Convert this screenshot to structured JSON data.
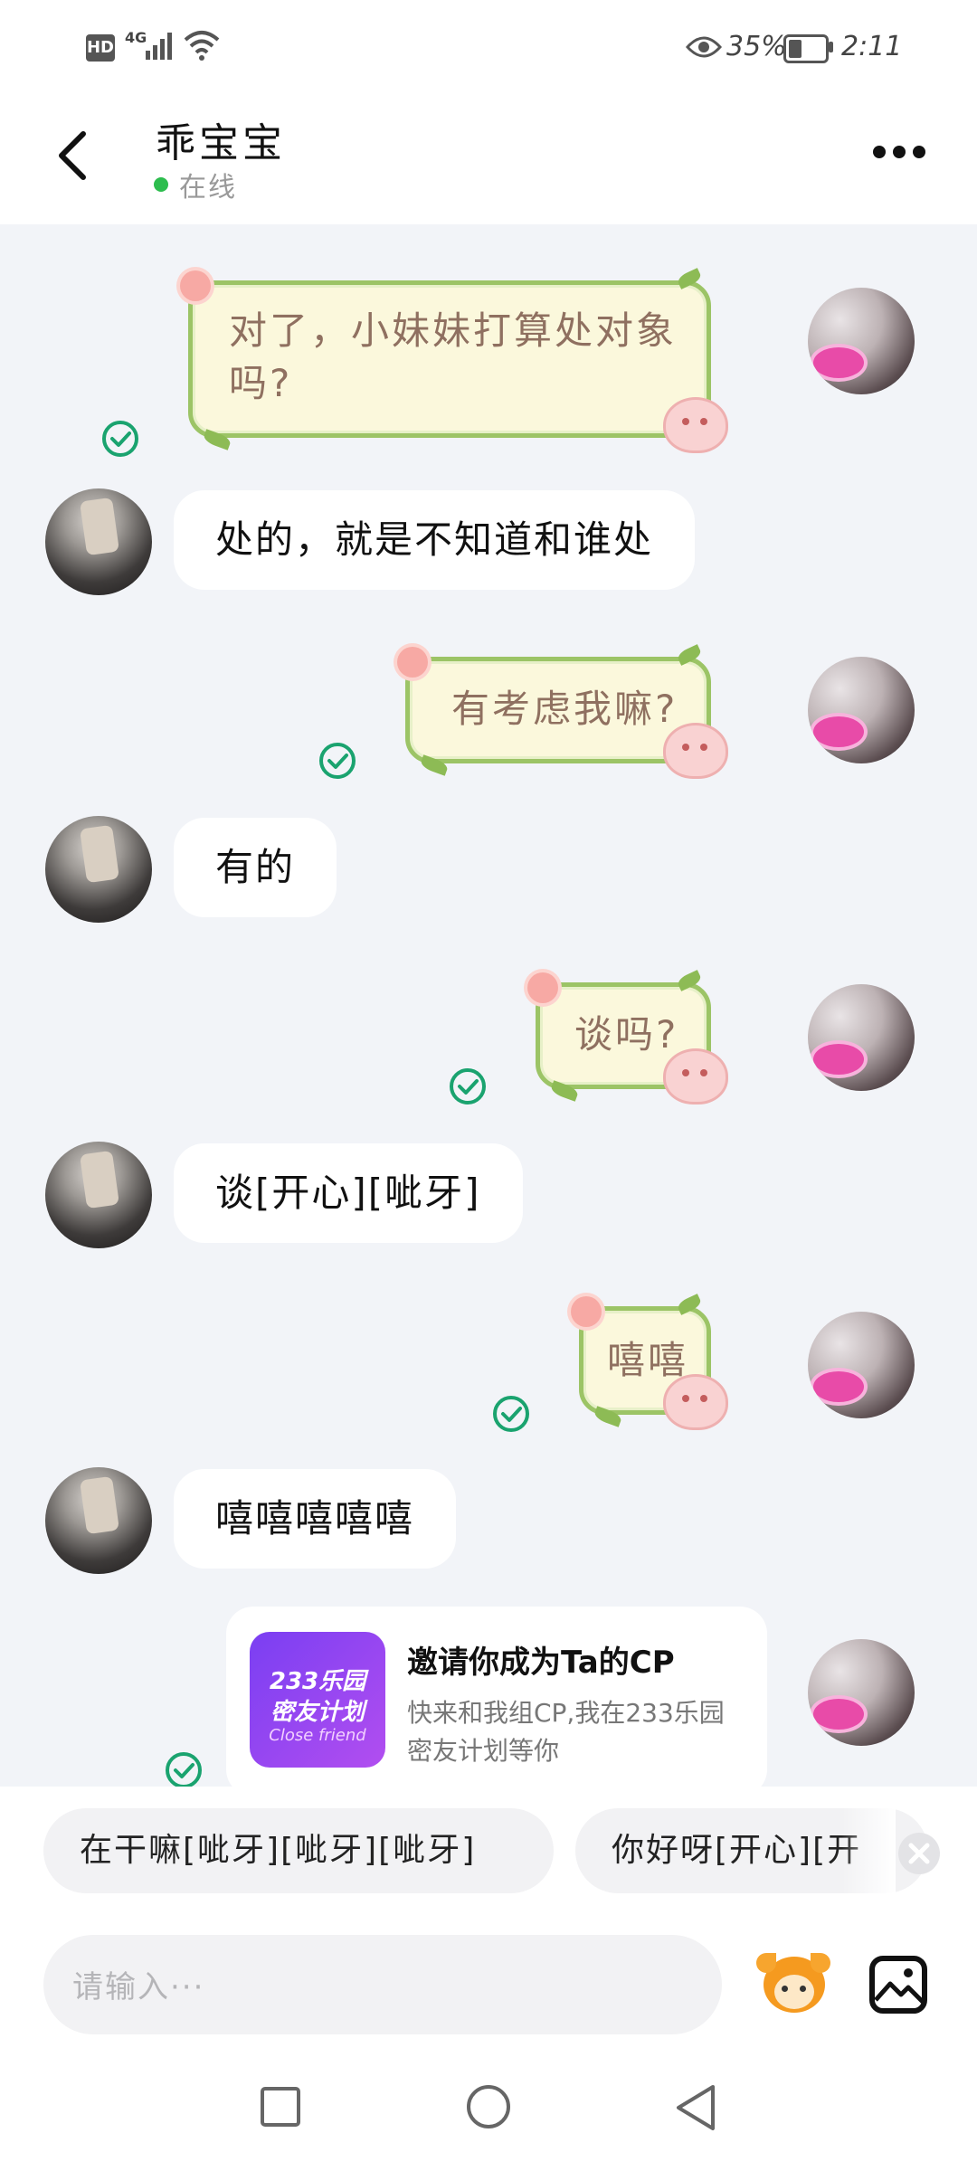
{
  "status_bar": {
    "hd_label": "HD",
    "network_label": "4G",
    "battery_percent": "35%",
    "time": "2:11"
  },
  "header": {
    "contact_name": "乖宝宝",
    "online_status": "在线",
    "online_color": "#2dbd4e"
  },
  "messages": [
    {
      "side": "sent",
      "text_lines": [
        "对了，小妹妹打算处对象",
        "吗?"
      ],
      "read": true
    },
    {
      "side": "received",
      "text": "处的，就是不知道和谁处"
    },
    {
      "side": "sent",
      "text_lines": [
        "有考虑我嘛?"
      ],
      "read": true
    },
    {
      "side": "received",
      "text": "有的"
    },
    {
      "side": "sent",
      "text_lines": [
        "谈吗?"
      ],
      "read": true
    },
    {
      "side": "received",
      "text": "谈[开心][呲牙]"
    },
    {
      "side": "sent",
      "text_lines": [
        "嘻嘻"
      ],
      "read": true
    },
    {
      "side": "received",
      "text": "嘻嘻嘻嘻嘻"
    }
  ],
  "invite_card": {
    "thumb_line1": "233乐园",
    "thumb_line2": "密友计划",
    "thumb_line3": "Close friend",
    "title": "邀请你成为Ta的CP",
    "desc_line1": "快来和我组CP,我在233乐园",
    "desc_line2": "密友计划等你",
    "read": true
  },
  "quick_replies": [
    "在干嘛[呲牙][呲牙][呲牙]",
    "你好呀[开心][开"
  ],
  "input": {
    "placeholder": "请输入···"
  },
  "colors": {
    "chat_background": "#f2f4f8",
    "sent_bubble": "#fbf8dc",
    "sent_border": "#9cc466",
    "read_check": "#1aa36f"
  },
  "icons": {
    "back": "back-arrow-icon",
    "more": "more-dots-icon",
    "emoji": "mascot-emoji-icon",
    "image": "image-icon",
    "close": "close-icon"
  }
}
